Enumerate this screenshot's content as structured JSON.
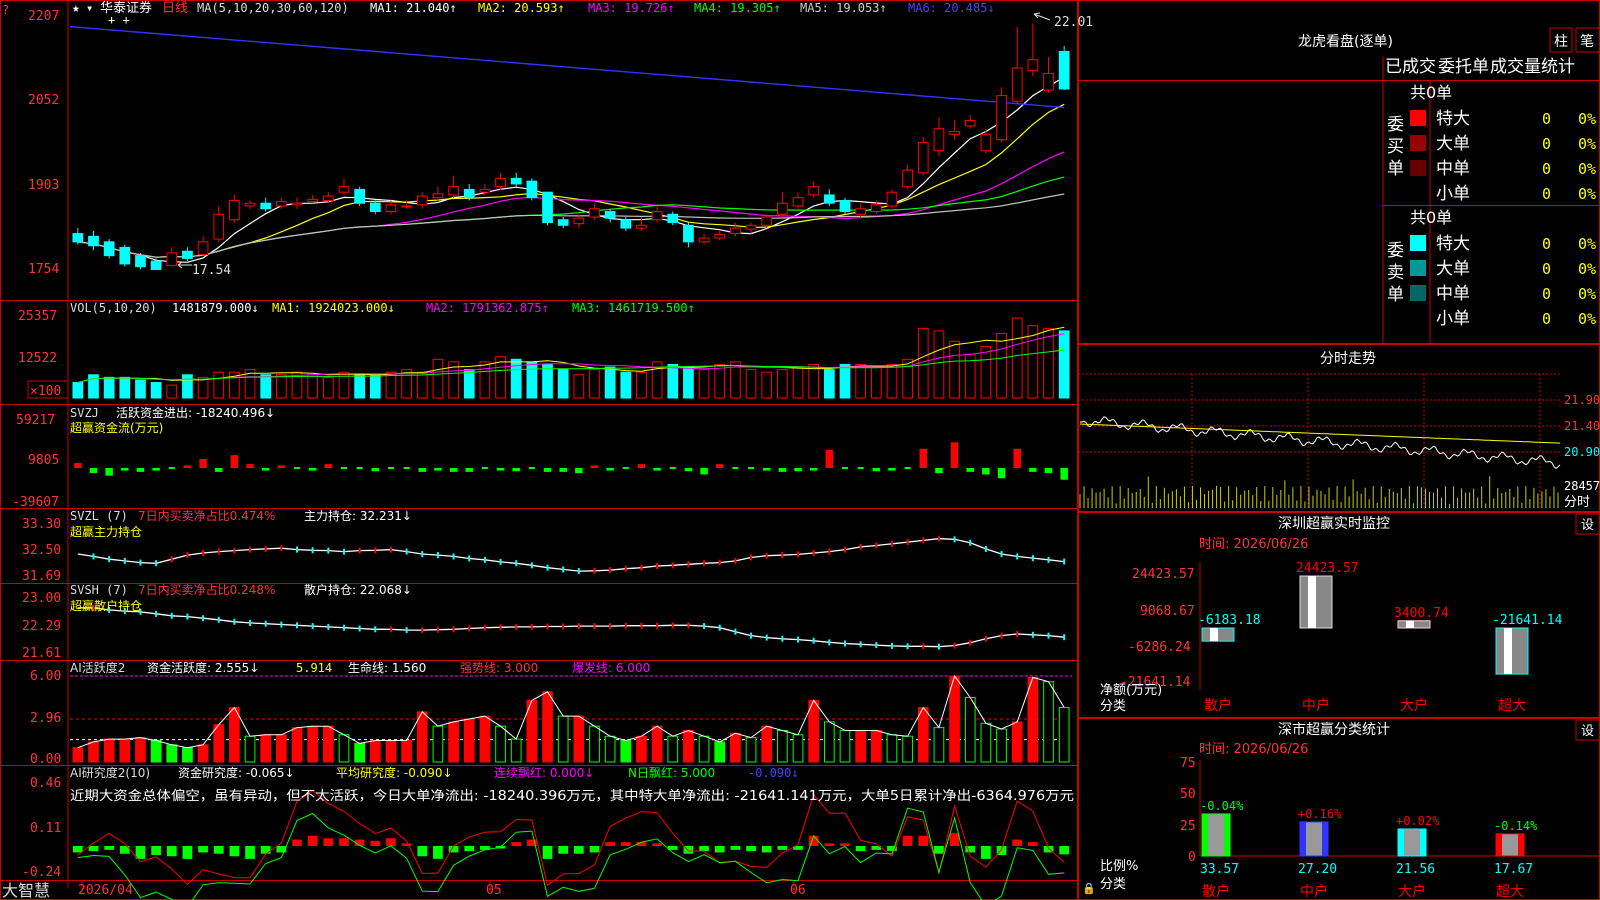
{
  "colors": {
    "up": "#ff0000",
    "down": "#00ffff",
    "panel_red": "#cc0000",
    "yellow": "#ffff00",
    "white": "#ffffff",
    "magenta": "#ff00ff",
    "green": "#00ff00",
    "blue": "#3333ff",
    "gray": "#c0c0c0"
  },
  "kline": {
    "stock_name": "华泰证券",
    "period": "日线",
    "ma_title": "MA(5,10,20,30,60,120)",
    "ma1": "MA1: 21.040↑",
    "ma2": "MA2: 20.593↑",
    "ma3": "MA3: 19.726↑",
    "ma4": "MA4: 19.305↑",
    "ma5": "MA5: 19.053↑",
    "ma6": "MA6: 20.485↓",
    "y_ticks": [
      "2207",
      "2052",
      "1903",
      "1754"
    ],
    "high_label": "22.01",
    "low_label": "17.54",
    "axis_prefix": "?"
  },
  "vol": {
    "title": "VOL(5,10,20)",
    "value": "1481879.000↓",
    "ma1": "MA1: 1924023.000↓",
    "ma2": "MA2: 1791362.875↑",
    "ma3": "MA3: 1461719.500↑",
    "y_ticks": [
      "25357",
      "12522"
    ],
    "unit": "×100"
  },
  "svzj": {
    "title": "SVZJ",
    "value": "活跃资金进出: -18240.496↓",
    "sub": "超赢资金流(万元)",
    "y_ticks": [
      "59217",
      "9805",
      "-39607"
    ]
  },
  "svzl": {
    "title": "SVZL (7)",
    "info": "7日内买卖净占比0.474%",
    "value": "主力持仓: 32.231↓",
    "sub": "超赢主力持仓",
    "y_ticks": [
      "33.30",
      "32.50",
      "31.69"
    ]
  },
  "svsh": {
    "title": "SVSH (7)",
    "info": "7日内买卖净占比0.248%",
    "value": "散户持仓: 22.068↓",
    "sub": "超赢散户持仓",
    "y_ticks": [
      "23.00",
      "22.29",
      "21.61"
    ]
  },
  "ai1": {
    "title": "AI活跃度2",
    "v1": "资金活跃度: 2.555↓",
    "v2": "5.914",
    "v3": "生命线: 1.560",
    "v4": "强势线: 3.000",
    "v5": "爆发线: 6.000",
    "y_ticks": [
      "6.00",
      "2.96",
      "0.00"
    ]
  },
  "ai2": {
    "title": "AI研究度2(10)",
    "v1": "资金研究度: -0.065↓",
    "v2": "平均研究度: -0.090↓",
    "v3": "连续飘红: 0.000↓",
    "v4": "N日飘红: 5.000",
    "v5": "-0.090↓",
    "comment": "近期大资金总体偏空，虽有异动，但不太活跃，今日大单净流出: -18240.396万元，其中特大单净流出: -21641.141万元，大单5日累计净出-6364.976万元",
    "y_ticks": [
      "0.46",
      "0.11",
      "-0.24"
    ]
  },
  "timeline": {
    "brand": "大智慧",
    "dates": [
      "2026/04",
      "05",
      "06"
    ]
  },
  "lhb": {
    "title": "龙虎看盘(逐单)",
    "btn_column": "柱",
    "btn_detail": "笔",
    "tabs": [
      "已成交",
      "委托单",
      "成交量统计"
    ],
    "buy_label": "委买单",
    "sell_label": "委卖单",
    "buy_total": "共0单",
    "sell_total": "共0单",
    "buy_rows": [
      {
        "label": "特大",
        "count": "0",
        "pct": "0%",
        "color": "#ff0000"
      },
      {
        "label": "大单",
        "count": "0",
        "pct": "0%",
        "color": "#990000"
      },
      {
        "label": "中单",
        "count": "0",
        "pct": "0%",
        "color": "#660000"
      },
      {
        "label": "小单",
        "count": "0",
        "pct": "0%",
        "color": ""
      }
    ],
    "sell_rows": [
      {
        "label": "特大",
        "count": "0",
        "pct": "0%",
        "color": "#00ffff"
      },
      {
        "label": "大单",
        "count": "0",
        "pct": "0%",
        "color": "#009999"
      },
      {
        "label": "中单",
        "count": "0",
        "pct": "0%",
        "color": "#006666"
      },
      {
        "label": "小单",
        "count": "0",
        "pct": "0%",
        "color": ""
      }
    ]
  },
  "intraday": {
    "title": "分时走势",
    "y_ticks": [
      "21.90",
      "21.40",
      "20.90"
    ],
    "vol_label": "28457",
    "unit_label": "分时"
  },
  "monitor": {
    "title": "深圳超赢实时监控",
    "settings": "设",
    "time": "时间: 2026/06/26",
    "y_ticks": [
      "24423.57",
      "9068.67",
      "-6286.24",
      "-21641.14"
    ],
    "net_label": "净额(万元)",
    "cat_label": "分类",
    "bars": [
      {
        "name": "散户",
        "value": -6183.18,
        "label": "-6183.18"
      },
      {
        "name": "中户",
        "value": 24423.57,
        "label": "24423.57"
      },
      {
        "name": "大户",
        "value": 3400.74,
        "label": "3400.74"
      },
      {
        "name": "超大",
        "value": -21641.14,
        "label": "-21641.14"
      }
    ]
  },
  "classify": {
    "title": "深市超赢分类统计",
    "settings": "设",
    "time": "时间: 2026/06/26",
    "y_ticks": [
      "75",
      "50",
      "25",
      "0"
    ],
    "ratio_label": "比例%",
    "cat_label": "分类",
    "bars": [
      {
        "name": "散户",
        "value": 33.57,
        "change": "-0.04%",
        "color": "#00ff00"
      },
      {
        "name": "中户",
        "value": 27.2,
        "change": "+0.16%",
        "color": "#3333ff"
      },
      {
        "name": "大户",
        "value": 21.56,
        "change": "+0.02%",
        "color": "#00ffff"
      },
      {
        "name": "超大",
        "value": 17.67,
        "change": "-0.14%",
        "color": "#ff0000"
      }
    ]
  },
  "chart_data": [
    {
      "type": "candlestick",
      "title": "华泰证券 日线",
      "ylim": [
        17.54,
        22.07
      ],
      "x": [
        1,
        2,
        3,
        4,
        5,
        6,
        7,
        8,
        9,
        10,
        11,
        12,
        13,
        14,
        15,
        16,
        17,
        18,
        19,
        20,
        21,
        22,
        23,
        24,
        25,
        26,
        27,
        28,
        29,
        30,
        31,
        32,
        33,
        34,
        35,
        36,
        37,
        38,
        39,
        40,
        41,
        42,
        43,
        44,
        45,
        46,
        47,
        48,
        49,
        50,
        51,
        52,
        53,
        54,
        55,
        56,
        57,
        58,
        59,
        60,
        61,
        62,
        63,
        64
      ],
      "open": [
        18.2,
        18.15,
        18.05,
        17.95,
        17.8,
        17.7,
        17.62,
        17.88,
        17.82,
        18.1,
        18.45,
        18.7,
        18.75,
        18.7,
        18.72,
        18.78,
        18.8,
        18.95,
        19.0,
        18.75,
        18.6,
        18.7,
        18.72,
        18.85,
        18.9,
        19.0,
        18.95,
        19.05,
        19.2,
        19.15,
        18.95,
        18.45,
        18.38,
        18.5,
        18.6,
        18.45,
        18.3,
        18.45,
        18.55,
        18.35,
        18.05,
        18.12,
        18.2,
        18.28,
        18.35,
        18.55,
        18.7,
        18.9,
        18.9,
        18.8,
        18.55,
        18.6,
        18.7,
        19.05,
        19.3,
        19.7,
        20.0,
        20.15,
        19.7,
        19.9,
        20.6,
        21.15,
        20.8,
        21.5
      ],
      "close": [
        18.05,
        17.98,
        17.8,
        17.65,
        17.6,
        17.55,
        17.85,
        17.75,
        18.05,
        18.55,
        18.8,
        18.75,
        18.65,
        18.78,
        18.75,
        18.82,
        18.88,
        19.05,
        18.75,
        18.6,
        18.72,
        18.7,
        18.88,
        18.92,
        19.05,
        18.85,
        19.0,
        19.2,
        19.1,
        18.85,
        18.4,
        18.35,
        18.48,
        18.65,
        18.48,
        18.3,
        18.35,
        18.6,
        18.4,
        18.05,
        18.12,
        18.18,
        18.3,
        18.35,
        18.5,
        18.75,
        18.85,
        19.05,
        18.75,
        18.6,
        18.65,
        18.72,
        18.95,
        19.35,
        19.85,
        20.1,
        20.05,
        20.25,
        20.0,
        20.7,
        21.2,
        21.35,
        21.1,
        20.82
      ],
      "high": [
        18.3,
        18.25,
        18.1,
        18.0,
        17.85,
        17.75,
        17.95,
        17.95,
        18.15,
        18.7,
        18.9,
        18.8,
        18.85,
        18.85,
        18.85,
        18.9,
        18.95,
        19.2,
        19.05,
        18.8,
        18.8,
        18.8,
        18.95,
        19.05,
        19.25,
        19.1,
        19.1,
        19.3,
        19.3,
        19.2,
        18.95,
        18.5,
        18.55,
        18.75,
        18.65,
        18.5,
        18.5,
        18.7,
        18.6,
        18.4,
        18.2,
        18.25,
        18.4,
        18.4,
        18.55,
        18.95,
        18.95,
        19.15,
        19.0,
        18.85,
        18.75,
        18.8,
        19.0,
        19.45,
        19.95,
        20.3,
        20.25,
        20.35,
        20.1,
        20.85,
        21.95,
        22.01,
        21.4,
        21.6
      ],
      "low": [
        18.0,
        17.9,
        17.75,
        17.6,
        17.55,
        17.54,
        17.6,
        17.7,
        17.8,
        18.05,
        18.4,
        18.65,
        18.6,
        18.65,
        18.65,
        18.75,
        18.75,
        18.9,
        18.7,
        18.55,
        18.55,
        18.65,
        18.65,
        18.8,
        18.85,
        18.8,
        18.9,
        19.0,
        19.05,
        18.8,
        18.35,
        18.3,
        18.3,
        18.45,
        18.4,
        18.25,
        18.25,
        18.4,
        18.35,
        17.95,
        18.0,
        18.08,
        18.15,
        18.2,
        18.3,
        18.5,
        18.65,
        18.85,
        18.7,
        18.55,
        18.5,
        18.55,
        18.65,
        19.0,
        19.25,
        19.6,
        19.9,
        20.1,
        19.65,
        19.85,
        20.55,
        21.05,
        20.75,
        20.8
      ]
    },
    {
      "type": "bar",
      "title": "VOL(5,10,20)",
      "values": [
        6,
        9,
        8,
        8,
        7,
        6,
        5,
        9,
        8,
        10,
        10,
        11,
        9,
        9,
        10,
        9,
        8,
        10,
        9,
        9,
        10,
        11,
        10,
        15,
        14,
        11,
        14,
        16,
        15,
        14,
        13,
        11,
        9,
        11,
        12,
        10,
        10,
        14,
        13,
        12,
        11,
        13,
        14,
        11,
        10,
        11,
        12,
        13,
        11,
        13,
        13,
        12,
        13,
        15,
        27,
        26,
        22,
        17,
        20,
        25,
        31,
        28,
        27,
        26
      ],
      "ylim": [
        0,
        31
      ],
      "ylabel": "×100"
    },
    {
      "type": "bar",
      "title": "SVZJ 活跃资金进出",
      "values": [
        8000,
        -8000,
        -12000,
        -4000,
        -6000,
        -4000,
        -2000,
        4000,
        14000,
        -6000,
        20000,
        6000,
        -4000,
        4000,
        -3000,
        -4000,
        6000,
        -3000,
        -2000,
        -5000,
        -3000,
        -3000,
        -6000,
        -4000,
        -6000,
        -6000,
        -3000,
        -4000,
        -5000,
        -3000,
        -6000,
        -6000,
        -8000,
        4000,
        -4000,
        -3000,
        6000,
        -4000,
        -3000,
        -5000,
        -10000,
        6000,
        -3000,
        -3000,
        -4000,
        -6000,
        -5000,
        -4000,
        28000,
        -3000,
        -3000,
        -5000,
        -4000,
        -3000,
        30000,
        -8000,
        40000,
        -6000,
        -10000,
        -16000,
        30000,
        -6000,
        -8000,
        -18240
      ]
    },
    {
      "type": "line",
      "title": "SVZL 主力持仓",
      "values": [
        32.45,
        32.38,
        32.3,
        32.25,
        32.2,
        32.18,
        32.3,
        32.42,
        32.48,
        32.52,
        32.55,
        32.58,
        32.6,
        32.62,
        32.58,
        32.56,
        32.55,
        32.52,
        32.55,
        32.56,
        32.58,
        32.52,
        32.45,
        32.42,
        32.38,
        32.32,
        32.28,
        32.22,
        32.18,
        32.12,
        32.05,
        32.0,
        31.95,
        31.96,
        31.98,
        32.02,
        32.05,
        32.1,
        32.12,
        32.15,
        32.18,
        32.2,
        32.25,
        32.35,
        32.4,
        32.42,
        32.44,
        32.48,
        32.52,
        32.58,
        32.66,
        32.7,
        32.75,
        32.8,
        32.85,
        32.9,
        32.88,
        32.78,
        32.6,
        32.45,
        32.38,
        32.33,
        32.28,
        32.23
      ]
    },
    {
      "type": "line",
      "title": "SVSH 散户持仓",
      "values": [
        22.8,
        22.8,
        22.75,
        22.72,
        22.7,
        22.65,
        22.6,
        22.58,
        22.54,
        22.5,
        22.45,
        22.42,
        22.4,
        22.38,
        22.36,
        22.34,
        22.32,
        22.3,
        22.28,
        22.26,
        22.26,
        22.24,
        22.24,
        22.25,
        22.26,
        22.28,
        22.3,
        22.31,
        22.32,
        22.32,
        22.33,
        22.33,
        22.34,
        22.34,
        22.34,
        22.35,
        22.35,
        22.35,
        22.36,
        22.36,
        22.34,
        22.3,
        22.2,
        22.1,
        22.05,
        22.02,
        22.0,
        21.97,
        21.93,
        21.9,
        21.88,
        21.86,
        21.84,
        21.83,
        21.83,
        21.82,
        21.85,
        21.92,
        22.02,
        22.1,
        22.14,
        22.12,
        22.1,
        22.06
      ]
    },
    {
      "type": "bar",
      "title": "AI活跃度2 资金活跃度",
      "values": [
        1.0,
        1.4,
        1.6,
        1.6,
        1.7,
        1.5,
        1.2,
        1.0,
        1.2,
        2.6,
        3.8,
        1.8,
        1.9,
        1.9,
        2.4,
        2.5,
        2.5,
        1.9,
        1.3,
        1.5,
        1.5,
        1.5,
        3.5,
        2.5,
        2.8,
        3.0,
        3.2,
        2.5,
        1.6,
        4.3,
        4.9,
        3.2,
        3.2,
        2.5,
        1.8,
        1.5,
        1.8,
        2.5,
        1.8,
        2.2,
        1.8,
        1.4,
        2.0,
        1.7,
        2.5,
        2.2,
        1.9,
        4.3,
        2.8,
        2.2,
        2.2,
        2.2,
        1.9,
        1.8,
        3.8,
        2.4,
        6.0,
        4.5,
        2.7,
        2.3,
        2.8,
        5.9,
        5.6,
        3.8
      ]
    },
    {
      "type": "bar",
      "title": "AI研究度2(10) 资金研究度",
      "values": [
        -0.05,
        -0.04,
        -0.03,
        -0.06,
        -0.1,
        -0.07,
        -0.08,
        -0.1,
        -0.05,
        -0.06,
        -0.08,
        -0.1,
        -0.06,
        -0.05,
        0.05,
        0.08,
        0.06,
        0.06,
        0.05,
        0.04,
        0.06,
        0.02,
        -0.08,
        -0.1,
        -0.05,
        -0.04,
        -0.03,
        -0.02,
        0.03,
        0.05,
        -0.1,
        -0.06,
        -0.06,
        -0.05,
        0.03,
        0.03,
        0.03,
        0.02,
        -0.03,
        -0.06,
        -0.04,
        -0.05,
        -0.03,
        -0.04,
        -0.05,
        -0.03,
        -0.03,
        0.08,
        0.02,
        0.02,
        -0.04,
        -0.03,
        -0.04,
        0.08,
        0.08,
        -0.06,
        0.1,
        -0.05,
        -0.1,
        -0.07,
        0.05,
        0.03,
        -0.05,
        -0.065
      ]
    },
    {
      "type": "bar",
      "title": "深圳超赢实时监控",
      "categories": [
        "散户",
        "中户",
        "大户",
        "超大"
      ],
      "values": [
        -6183.18,
        24423.57,
        3400.74,
        -21641.14
      ],
      "ylim": [
        -21641.14,
        24423.57
      ]
    },
    {
      "type": "bar",
      "title": "深市超赢分类统计",
      "categories": [
        "散户",
        "中户",
        "大户",
        "超大"
      ],
      "values": [
        33.57,
        27.2,
        21.56,
        17.67
      ],
      "ylim": [
        0,
        75
      ]
    }
  ]
}
